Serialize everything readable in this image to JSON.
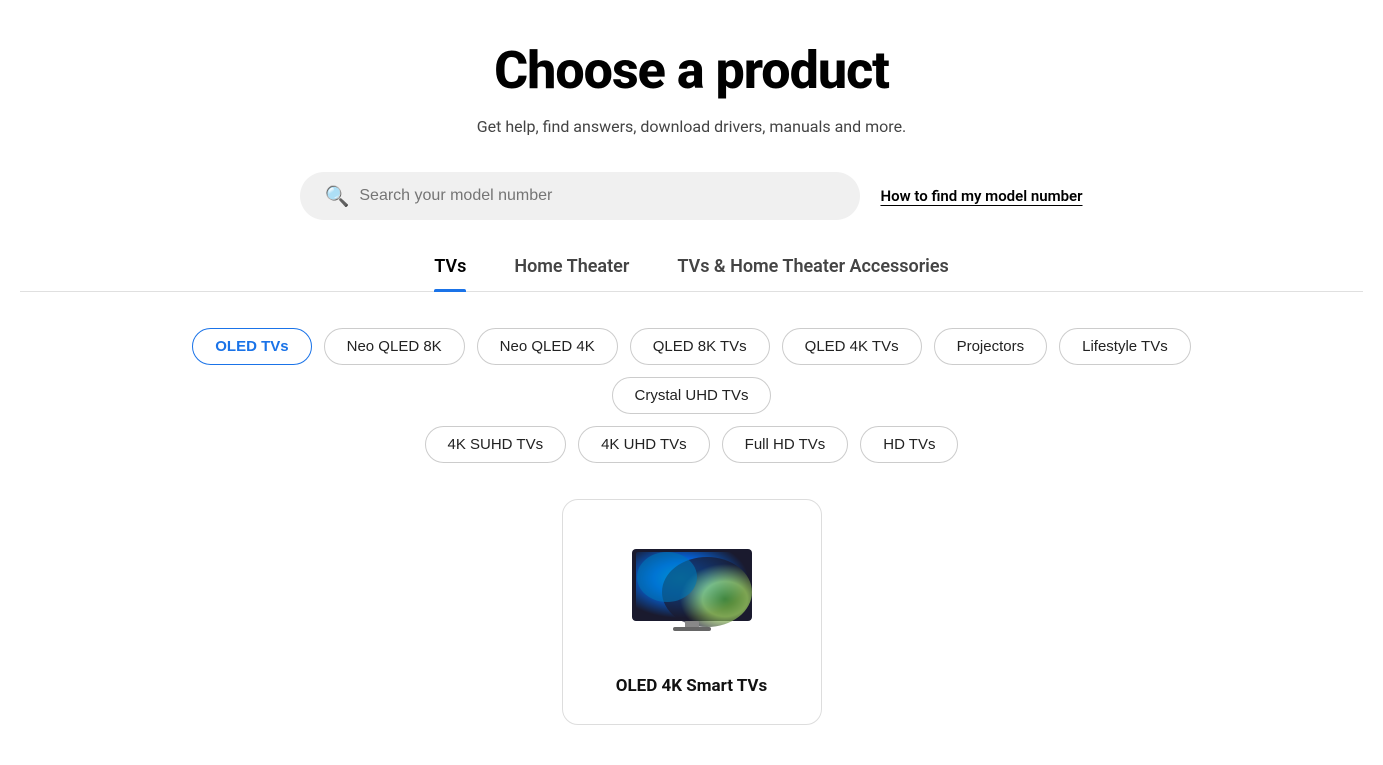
{
  "header": {
    "title": "Choose a product",
    "subtitle": "Get help, find answers, download drivers, manuals and more."
  },
  "search": {
    "placeholder": "Search your model number",
    "find_model_link": "How to find my model number"
  },
  "tabs": [
    {
      "id": "tvs",
      "label": "TVs",
      "active": true
    },
    {
      "id": "home-theater",
      "label": "Home Theater",
      "active": false
    },
    {
      "id": "accessories",
      "label": "TVs & Home Theater Accessories",
      "active": false
    }
  ],
  "filters": {
    "row1": [
      {
        "id": "oled-tvs",
        "label": "OLED TVs",
        "active": true
      },
      {
        "id": "neo-qled-8k",
        "label": "Neo QLED 8K",
        "active": false
      },
      {
        "id": "neo-qled-4k",
        "label": "Neo QLED 4K",
        "active": false
      },
      {
        "id": "qled-8k-tvs",
        "label": "QLED 8K TVs",
        "active": false
      },
      {
        "id": "qled-4k-tvs",
        "label": "QLED 4K TVs",
        "active": false
      },
      {
        "id": "projectors",
        "label": "Projectors",
        "active": false
      },
      {
        "id": "lifestyle-tvs",
        "label": "Lifestyle TVs",
        "active": false
      },
      {
        "id": "crystal-uhd-tvs",
        "label": "Crystal UHD TVs",
        "active": false
      }
    ],
    "row2": [
      {
        "id": "4k-suhd-tvs",
        "label": "4K SUHD TVs",
        "active": false
      },
      {
        "id": "4k-uhd-tvs",
        "label": "4K UHD TVs",
        "active": false
      },
      {
        "id": "full-hd-tvs",
        "label": "Full HD TVs",
        "active": false
      },
      {
        "id": "hd-tvs",
        "label": "HD TVs",
        "active": false
      }
    ]
  },
  "products": [
    {
      "id": "oled-4k-smart-tvs",
      "name": "OLED 4K Smart TVs"
    }
  ],
  "colors": {
    "accent": "#1a73e8",
    "tab_underline": "#1a73e8"
  }
}
